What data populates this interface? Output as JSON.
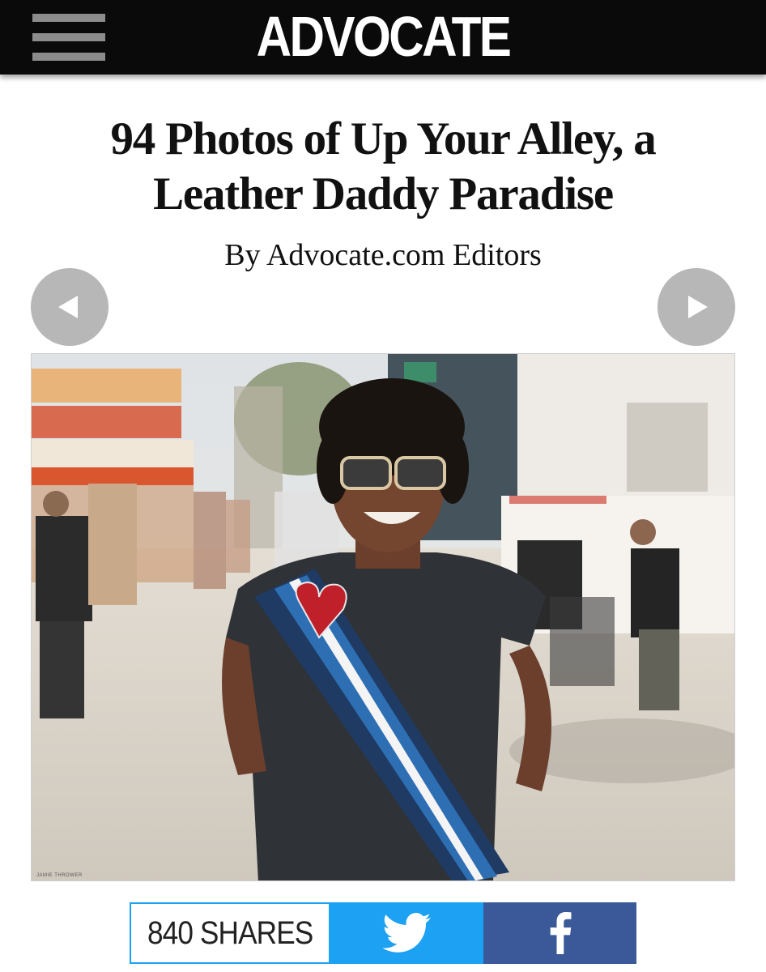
{
  "header": {
    "logo_text": "ADVOCATE",
    "menu_icon": "hamburger-menu-icon"
  },
  "article": {
    "title_line1": "94 Photos of Up Your Alley, a",
    "title_line2": "Leather Daddy Paradise",
    "byline": "By Advocate.com Editors"
  },
  "gallery": {
    "prev_icon": "chevron-left-icon",
    "next_icon": "chevron-right-icon",
    "photo_credit": "JAMIE THROWER"
  },
  "share": {
    "count_label": "840 SHARES",
    "twitter_icon": "twitter-bird-icon",
    "facebook_icon": "facebook-f-icon"
  },
  "colors": {
    "header_bg": "#0a0a0a",
    "nav_circle": "#b7b7b7",
    "twitter": "#1da1f2",
    "facebook": "#3b5998"
  }
}
